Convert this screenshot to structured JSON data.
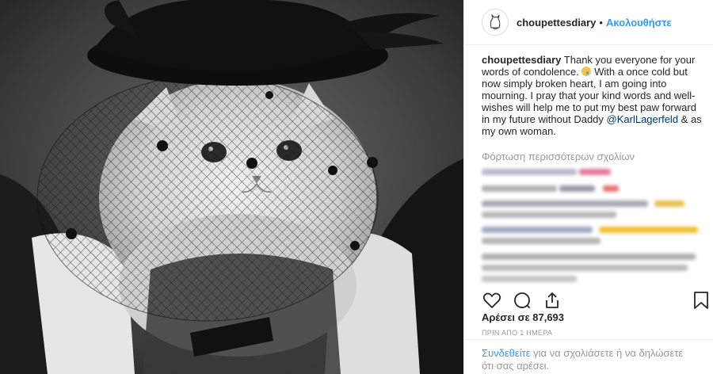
{
  "post": {
    "username": "choupettesdiary",
    "follow_separator": "•",
    "follow_label": "Ακολουθήστε",
    "caption_username": "choupettesdiary",
    "caption_part1": " Thank you everyone for your words of condolence. ",
    "caption_part2": " With a once cold but now simply broken heart, I am going into mourning. I pray that your kind words and well-wishes will help me to put my best paw forward in my future without Daddy ",
    "mention": "@KarlLagerfeld",
    "caption_part3": " & as my own woman.",
    "load_more_label": "Φόρτωση περισσότερων σχολίων",
    "likes_label": "Αρέσει σε 87,693",
    "time_label": "ΠΡΙΝ ΑΠΟ 1 ΗΜΕΡΑ",
    "footer_login": "Συνδεθείτε",
    "footer_rest": " για να σχολιάσετε ή να δηλώσετε ότι σας αρέσει."
  },
  "icons": {
    "like": "heart-icon",
    "comment": "comment-icon",
    "share": "share-icon",
    "save": "bookmark-icon",
    "emoji": "crying-face-emoji"
  },
  "colors": {
    "link": "#3897f0",
    "mention": "#003569",
    "muted": "#999999",
    "text": "#262626"
  }
}
